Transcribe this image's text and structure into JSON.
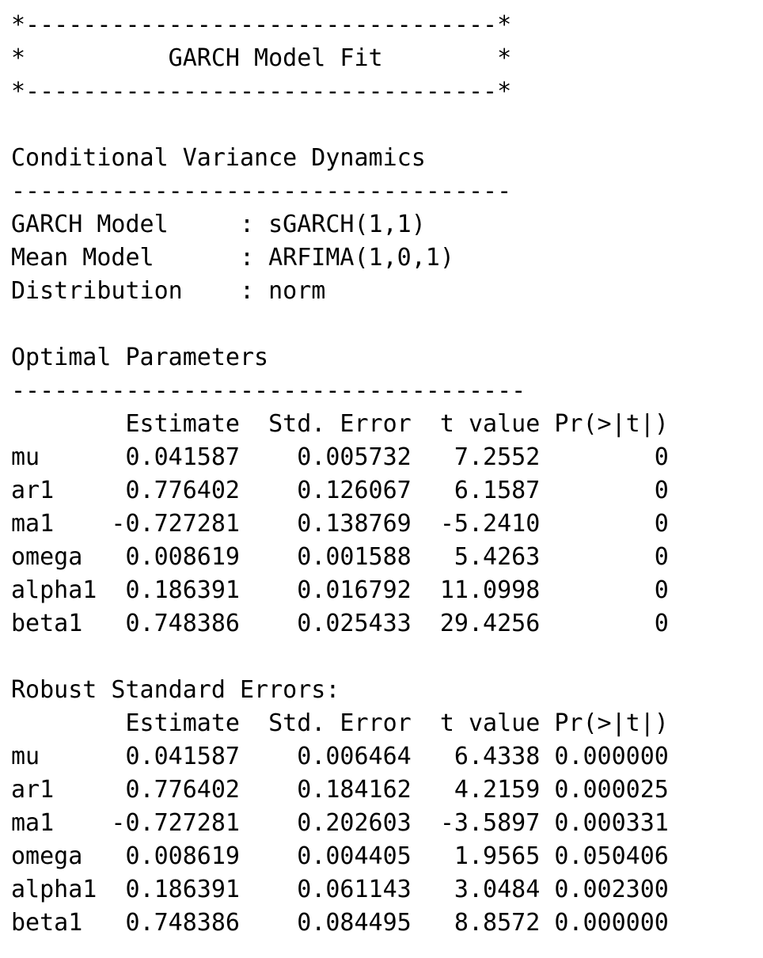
{
  "document": {
    "lines": [
      "*---------------------------------*",
      "*          GARCH Model Fit        *",
      "*---------------------------------*",
      "",
      "Conditional Variance Dynamics",
      "-----------------------------------",
      "GARCH Model     : sGARCH(1,1)",
      "Mean Model      : ARFIMA(1,0,1)",
      "Distribution    : norm",
      "",
      "Optimal Parameters",
      "------------------------------------",
      "        Estimate  Std. Error  t value Pr(>|t|)",
      "mu      0.041587    0.005732   7.2552        0",
      "ar1     0.776402    0.126067   6.1587        0",
      "ma1    -0.727281    0.138769  -5.2410        0",
      "omega   0.008619    0.001588   5.4263        0",
      "alpha1  0.186391    0.016792  11.0998        0",
      "beta1   0.748386    0.025433  29.4256        0",
      "",
      "Robust Standard Errors:",
      "        Estimate  Std. Error  t value Pr(>|t|)",
      "mu      0.041587    0.006464   6.4338 0.000000",
      "ar1     0.776402    0.184162   4.2159 0.000025",
      "ma1    -0.727281    0.202603  -3.5897 0.000331",
      "omega   0.008619    0.004405   1.9565 0.050406",
      "alpha1  0.186391    0.061143   3.0484 0.002300",
      "beta1   0.748386    0.084495   8.8572 0.000000"
    ]
  }
}
